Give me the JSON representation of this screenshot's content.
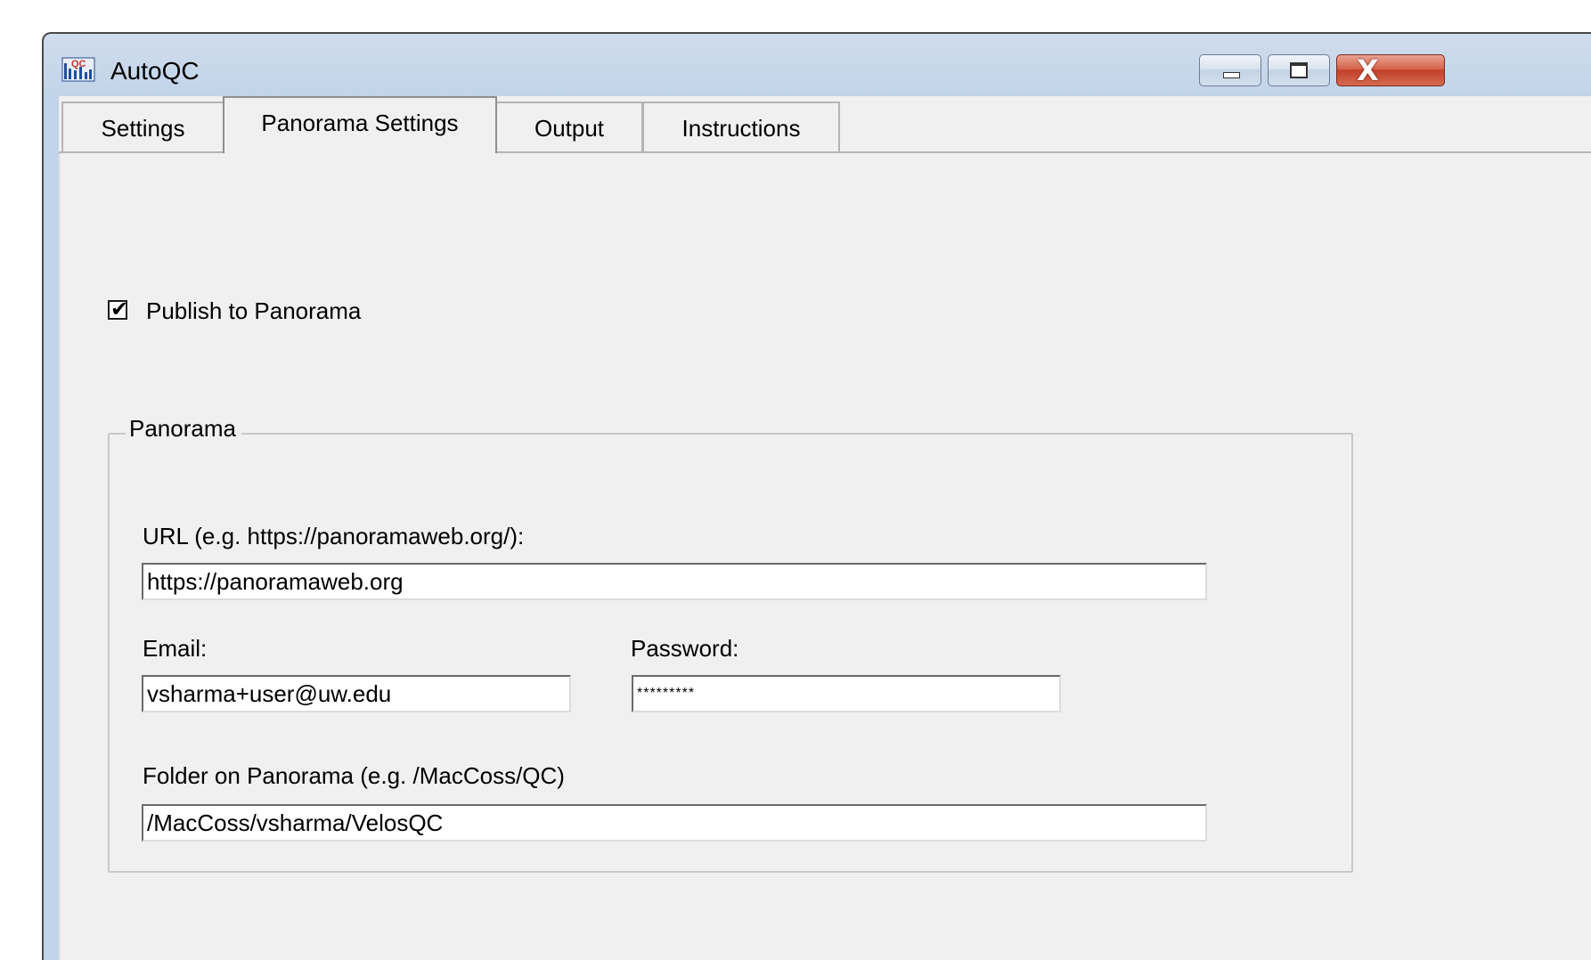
{
  "window": {
    "title": "AutoQC",
    "app_icon": "autoqc-app-icon",
    "controls": {
      "minimize_icon": "minimize-icon",
      "maximize_icon": "maximize-icon",
      "close_icon": "close-icon",
      "close_glyph": "X"
    }
  },
  "tabs": [
    {
      "label": "Settings",
      "selected": false
    },
    {
      "label": "Panorama Settings",
      "selected": true
    },
    {
      "label": "Output",
      "selected": false
    },
    {
      "label": "Instructions",
      "selected": false
    }
  ],
  "panorama_settings": {
    "publish_checkbox": {
      "label": "Publish to Panorama",
      "checked": true
    },
    "group_title": "Panorama",
    "url": {
      "label": "URL (e.g. https://panoramaweb.org/):",
      "value": "https://panoramaweb.org"
    },
    "email": {
      "label": "Email:",
      "value": "vsharma+user@uw.edu"
    },
    "password": {
      "label": "Password:",
      "value": "*********"
    },
    "folder": {
      "label": "Folder on Panorama (e.g. /MacCoss/QC)",
      "value": "/MacCoss/vsharma/VelosQC"
    }
  }
}
